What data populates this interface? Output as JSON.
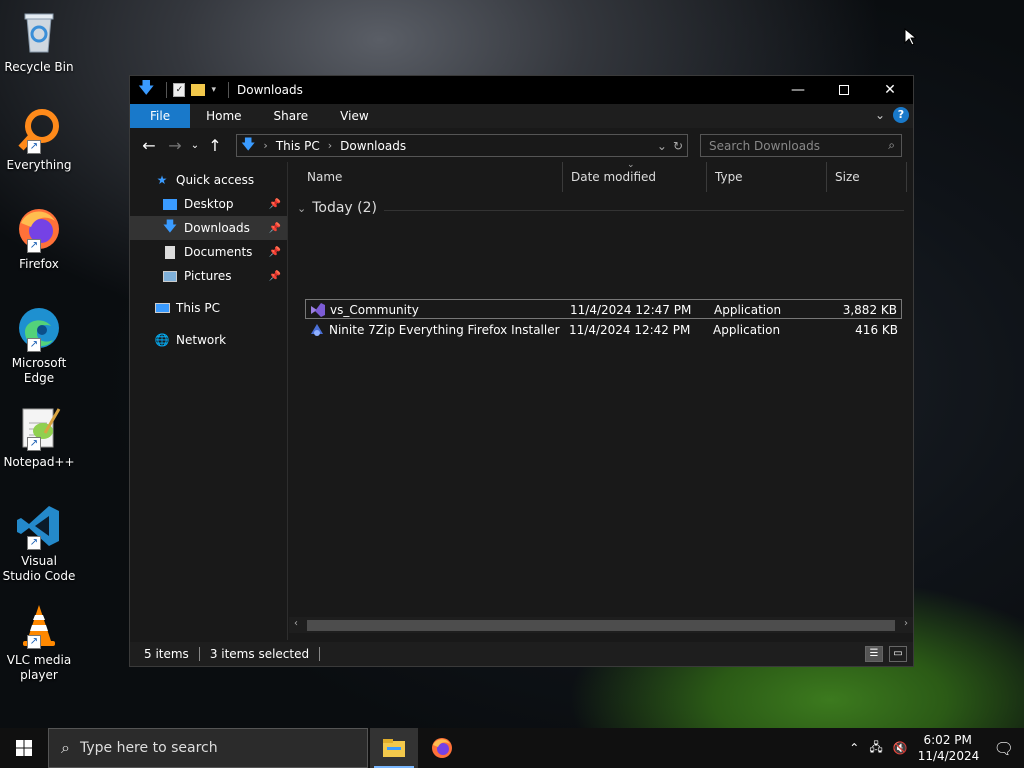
{
  "desktop": {
    "icons": [
      {
        "label": "Recycle Bin"
      },
      {
        "label": "Everything"
      },
      {
        "label": "Firefox"
      },
      {
        "label": "Microsoft Edge"
      },
      {
        "label": "Notepad++"
      },
      {
        "label": "Visual Studio Code"
      },
      {
        "label": "VLC media player"
      }
    ]
  },
  "window": {
    "title": "Downloads",
    "ribbon": {
      "file": "File",
      "home": "Home",
      "share": "Share",
      "view": "View"
    },
    "address": {
      "root": "This PC",
      "current": "Downloads"
    },
    "search_placeholder": "Search Downloads",
    "nav": {
      "quick_access": "Quick access",
      "desktop": "Desktop",
      "downloads": "Downloads",
      "documents": "Documents",
      "pictures": "Pictures",
      "this_pc": "This PC",
      "network": "Network"
    },
    "columns": {
      "name": "Name",
      "date": "Date modified",
      "type": "Type",
      "size": "Size"
    },
    "group_label": "Today (2)",
    "files": [
      {
        "name": "vs_Community",
        "date": "11/4/2024 12:47 PM",
        "type": "Application",
        "size": "3,882 KB"
      },
      {
        "name": "Ninite 7Zip Everything Firefox Installer",
        "date": "11/4/2024 12:42 PM",
        "type": "Application",
        "size": "416 KB"
      }
    ],
    "status": {
      "items": "5 items",
      "selected": "3 items selected"
    }
  },
  "taskbar": {
    "search_placeholder": "Type here to search",
    "time": "6:02 PM",
    "date": "11/4/2024"
  },
  "colors": {
    "accent": "#1979ca",
    "window_bg": "#191919",
    "titlebar": "#000000"
  }
}
